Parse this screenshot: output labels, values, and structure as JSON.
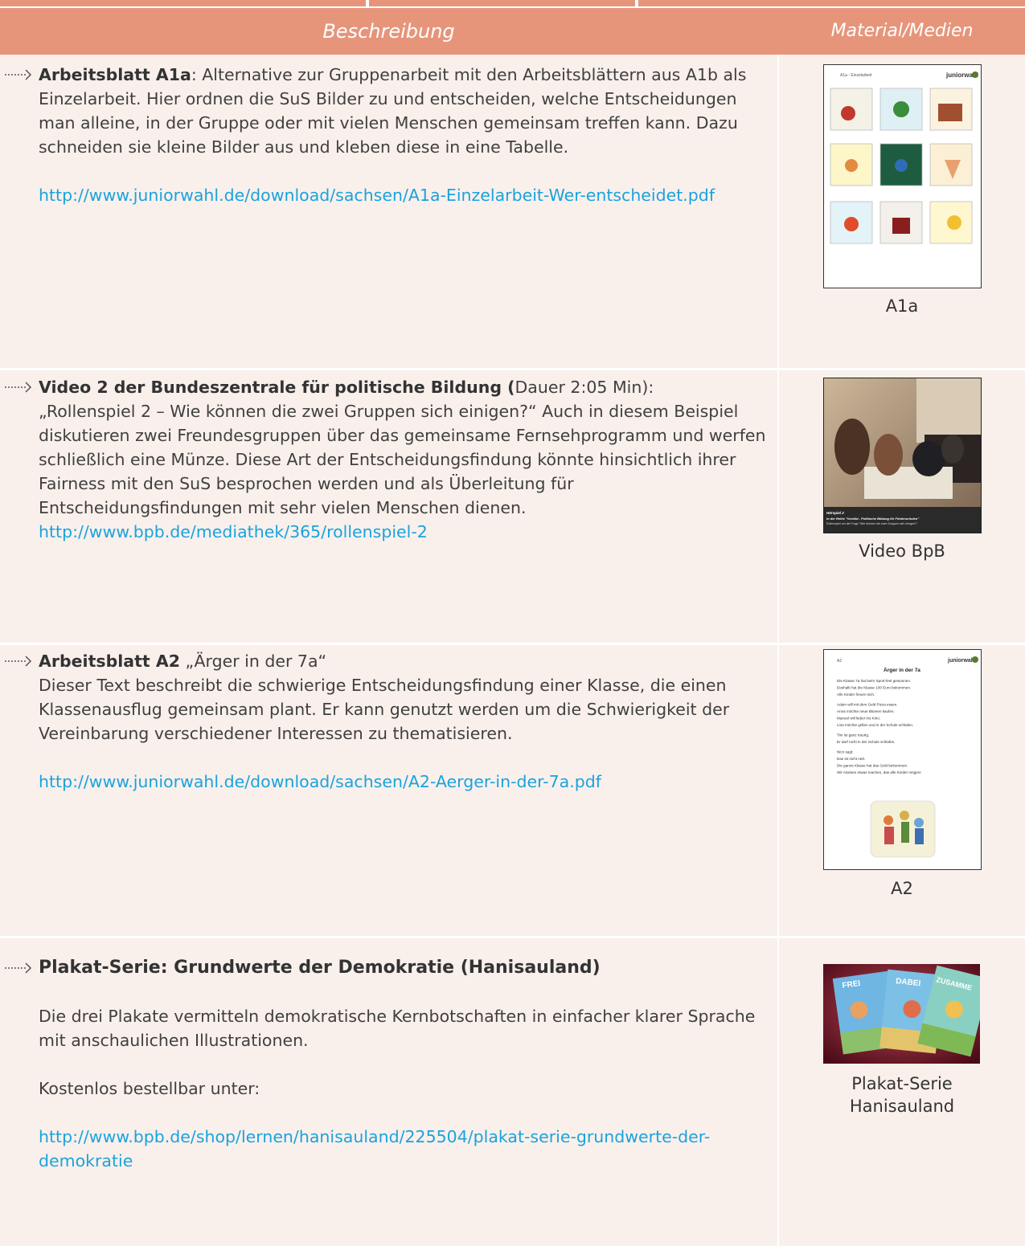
{
  "header": {
    "col_description": "Beschreibung",
    "col_material_line1": "Material/",
    "col_material_line2": "Medien"
  },
  "rows": [
    {
      "title": "Arbeitsblatt A1a",
      "sep": ":",
      "text": " Alternative zur Gruppenarbeit mit den Arbeitsblättern aus A1b als Einzelarbeit. Hier ordnen die SuS Bilder zu und entscheiden, welche Entscheidungen man alleine, in der Gruppe oder mit vielen Menschen gemeinsam treffen kann. Dazu schneiden sie kleine Bilder aus und kleben diese in eine Tabelle.",
      "link": "http://www.juniorwahl.de/download/sachsen/A1a-Einzelarbeit-Wer-entscheidet.pdf",
      "caption": "A1a",
      "thumb_header_left": "A1a - Einzelarbeit",
      "thumb_header_right": "juniorwahl"
    },
    {
      "title": "Video 2 der Bundeszentrale für politische Bildung (",
      "title_rest": "Dauer 2:05 Min):",
      "text": "„Rollenspiel 2 – Wie können die zwei Gruppen sich einigen?“ Auch in diesem Beispiel diskutieren zwei Freundesgruppen über das gemeinsame Fernsehprogramm und werfen schließlich eine Münze. Diese Art der Entscheidungsfindung könnte hinsichtlich ihrer Fairness mit den SuS  besprochen werden und als Überleitung für Entscheidungsfindungen mit sehr vielen Menschen dienen.",
      "link": "http://www.bpb.de/mediathek/365/rollenspiel-2",
      "caption": "Video BpB",
      "video_line1": "Hörspiel 2",
      "video_line2": "in der Reihe \"Vorbild - Politische Bildung für Förderschulen\"",
      "video_line3": "Rollenspiel um die Frage \"Wie können die zwei Gruppen sich einigen?\""
    },
    {
      "title": "Arbeitsblatt A2",
      "text_inline": " „Ärger in der 7a“",
      "text": "Dieser Text beschreibt die schwierige Entscheidungsfindung einer Klasse, die einen Klassenausflug gemeinsam plant. Er kann genutzt werden um die Schwierigkeit der Vereinbarung verschiedener Interessen zu thematisieren.",
      "link": "http://www.juniorwahl.de/download/sachsen/A2-Aerger-in-der-7a.pdf",
      "caption": "A2",
      "thumb_header_left": "A2",
      "thumb_header_right": "juniorwahl",
      "doc_title": "Ärger in der 7a",
      "doc_lines": [
        "Die Klasse 7a hat beim Sport-fest gewonnen.",
        "Deshalb hat die Klasse 100 Euro bekommen.",
        "Alle Kinder freuen sich.",
        "",
        "Adam will mit dem Geld Pizza essen.",
        "Anna möchte neue Blumen kaufen.",
        "Manuel will lieber ins Kino.",
        "Lina möchte grillen und in der Schule schlafen.",
        "",
        "Tim ist ganz traurig.",
        "Er darf nicht in der Schule schlafen.",
        "",
        "Nico sagt:",
        "Das ist nicht nett.",
        "Die ganze Klasse hat das Geld bekommen.",
        "Wir müssen etwas machen, das alle Kinder mögen!"
      ]
    },
    {
      "title": "Plakat-Serie: Grundwerte der Demokratie (Hanisauland)",
      "text1": "Die drei Plakate vermitteln demokratische Kernbotschaften in einfacher klarer Sprache mit anschaulichen Illustrationen.",
      "text2": "Kostenlos bestellbar unter:",
      "link": "http://www.bpb.de/shop/lernen/hanisauland/225504/plakat-serie-grundwerte-der-demokratie",
      "caption_line1": "Plakat-Serie",
      "caption_line2": "Hanisauland",
      "poster_words": [
        "FREI",
        "DABEI",
        "ZUSAMME"
      ]
    }
  ],
  "colors": {
    "header": "#e6957b",
    "row_bg": "#f9f0ec",
    "link": "#1aa3dd"
  }
}
